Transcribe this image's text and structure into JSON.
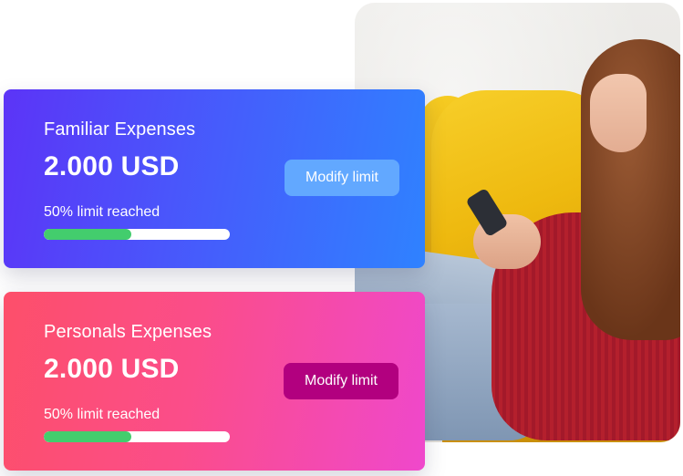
{
  "cards": [
    {
      "title": "Familiar Expenses",
      "amount": "2.000 USD",
      "progress_label": "50% limit reached",
      "progress_fraction": 0.47,
      "button_label": "Modify limit"
    },
    {
      "title": "Personals Expenses",
      "amount": "2.000 USD",
      "progress_label": "50% limit reached",
      "progress_fraction": 0.47,
      "button_label": "Modify limit"
    }
  ],
  "colors": {
    "familiar_gradient": [
      "#5c34f7",
      "#2f82ff"
    ],
    "personal_gradient": [
      "#fd4f6a",
      "#ef48cc"
    ],
    "progress_fill": "#43cd6d",
    "familiar_button": "#62a8ff",
    "personal_button": "#b2007f"
  },
  "photo": {
    "subject": "woman-on-yellow-armchair-using-phone"
  }
}
